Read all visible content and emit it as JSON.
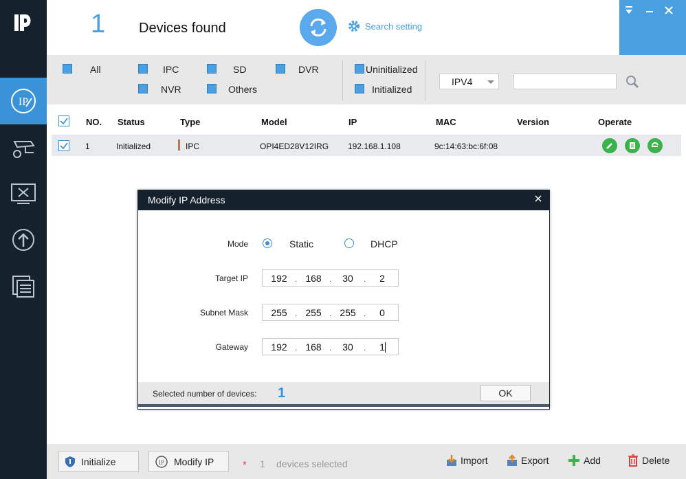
{
  "header": {
    "device_count": "1",
    "devices_found_label": "Devices found",
    "search_setting_label": "Search setting"
  },
  "filters": {
    "all": "All",
    "ipc": "IPC",
    "sd": "SD",
    "dvr": "DVR",
    "nvr": "NVR",
    "others": "Others",
    "uninitialized": "Uninitialized",
    "initialized": "Initialized",
    "ip_version": "IPV4",
    "search_value": ""
  },
  "table": {
    "columns": [
      "NO.",
      "Status",
      "Type",
      "Model",
      "IP",
      "MAC",
      "Version",
      "Operate"
    ],
    "rows": [
      {
        "no": "1",
        "status": "Initialized",
        "type": "IPC",
        "model": "OPI4ED28V12IRG",
        "ip": "192.168.1.108",
        "mac": "9c:14:63:bc:6f:08",
        "version": ""
      }
    ]
  },
  "modal": {
    "title": "Modify IP Address",
    "mode_label": "Mode",
    "static_label": "Static",
    "dhcp_label": "DHCP",
    "selected_mode": "Static",
    "target_ip_label": "Target IP",
    "subnet_mask_label": "Subnet Mask",
    "gateway_label": "Gateway",
    "target_ip": [
      "192",
      "168",
      "30",
      "2"
    ],
    "subnet_mask": [
      "255",
      "255",
      "255",
      "0"
    ],
    "gateway": [
      "192",
      "168",
      "30",
      "1"
    ],
    "selected_devices_label": "Selected number of devices:",
    "selected_devices_count": "1",
    "ok_label": "OK"
  },
  "bottom": {
    "initialize_label": "Initialize",
    "modify_ip_label": "Modify IP",
    "star": "*",
    "selected_count": "1",
    "devices_selected_label": "devices selected",
    "import_label": "Import",
    "export_label": "Export",
    "add_label": "Add",
    "delete_label": "Delete"
  },
  "colors": {
    "sidebar": "#15222e",
    "accent": "#4a9fe0",
    "operate_green": "#3cb34a",
    "delete_red": "#d94040"
  },
  "icons": [
    "logo-icon",
    "ip-tool-icon",
    "camera-config-icon",
    "tools-icon",
    "upgrade-icon",
    "documents-icon",
    "refresh-icon",
    "gear-icon",
    "search-icon",
    "edit-icon",
    "web-config-icon",
    "browser-icon",
    "shield-icon",
    "import-icon",
    "export-icon",
    "add-icon",
    "delete-icon"
  ]
}
